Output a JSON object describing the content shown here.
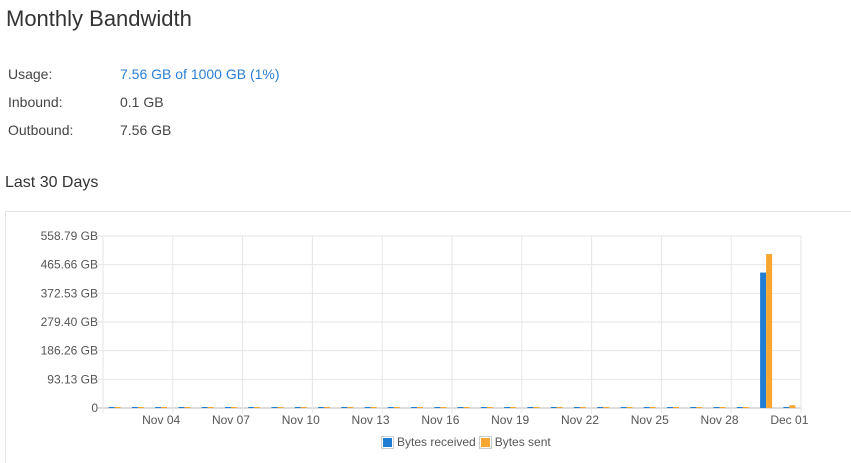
{
  "page": {
    "title": "Monthly Bandwidth"
  },
  "stats": {
    "usage_label": "Usage:",
    "usage_value": "7.56 GB of 1000 GB (1%)",
    "inbound_label": "Inbound:",
    "inbound_value": "0.1 GB",
    "outbound_label": "Outbound:",
    "outbound_value": "7.56 GB"
  },
  "section": {
    "title": "Last 30 Days"
  },
  "colors": {
    "received": "#1f7ed4",
    "sent": "#f8a630",
    "link": "#2a7fd4"
  },
  "chart_data": {
    "type": "bar",
    "ylim": [
      0,
      558.79
    ],
    "y_ticks": [
      0,
      93.13,
      186.26,
      279.4,
      372.53,
      465.66,
      558.79
    ],
    "y_tick_labels": [
      "0",
      "93.13 GB",
      "186.26 GB",
      "279.40 GB",
      "372.53 GB",
      "465.66 GB",
      "558.79 GB"
    ],
    "x_tick_labels": [
      "Nov 04",
      "Nov 07",
      "Nov 10",
      "Nov 13",
      "Nov 16",
      "Nov 19",
      "Nov 22",
      "Nov 25",
      "Nov 28",
      "Dec 01"
    ],
    "categories": [
      "Nov 02",
      "Nov 03",
      "Nov 04",
      "Nov 05",
      "Nov 06",
      "Nov 07",
      "Nov 08",
      "Nov 09",
      "Nov 10",
      "Nov 11",
      "Nov 12",
      "Nov 13",
      "Nov 14",
      "Nov 15",
      "Nov 16",
      "Nov 17",
      "Nov 18",
      "Nov 19",
      "Nov 20",
      "Nov 21",
      "Nov 22",
      "Nov 23",
      "Nov 24",
      "Nov 25",
      "Nov 26",
      "Nov 27",
      "Nov 28",
      "Nov 29",
      "Nov 30",
      "Dec 01"
    ],
    "series": [
      {
        "name": "Bytes received",
        "color": "#1f7ed4",
        "values": [
          1,
          1,
          1,
          1,
          1,
          1,
          1,
          1,
          1,
          1,
          1,
          1,
          1,
          1,
          1,
          1,
          1,
          1,
          1,
          1,
          1,
          1,
          1,
          1,
          1,
          1,
          1,
          1,
          440,
          2
        ]
      },
      {
        "name": "Bytes sent",
        "color": "#f8a630",
        "values": [
          1,
          1,
          1,
          1,
          1,
          1,
          1,
          1,
          1,
          1,
          1,
          1,
          1,
          1,
          1,
          1,
          1,
          1,
          1,
          1,
          1,
          1,
          1,
          1,
          1,
          1,
          1,
          1,
          500,
          9
        ]
      }
    ],
    "legend_position": "bottom-center",
    "grid": true
  }
}
